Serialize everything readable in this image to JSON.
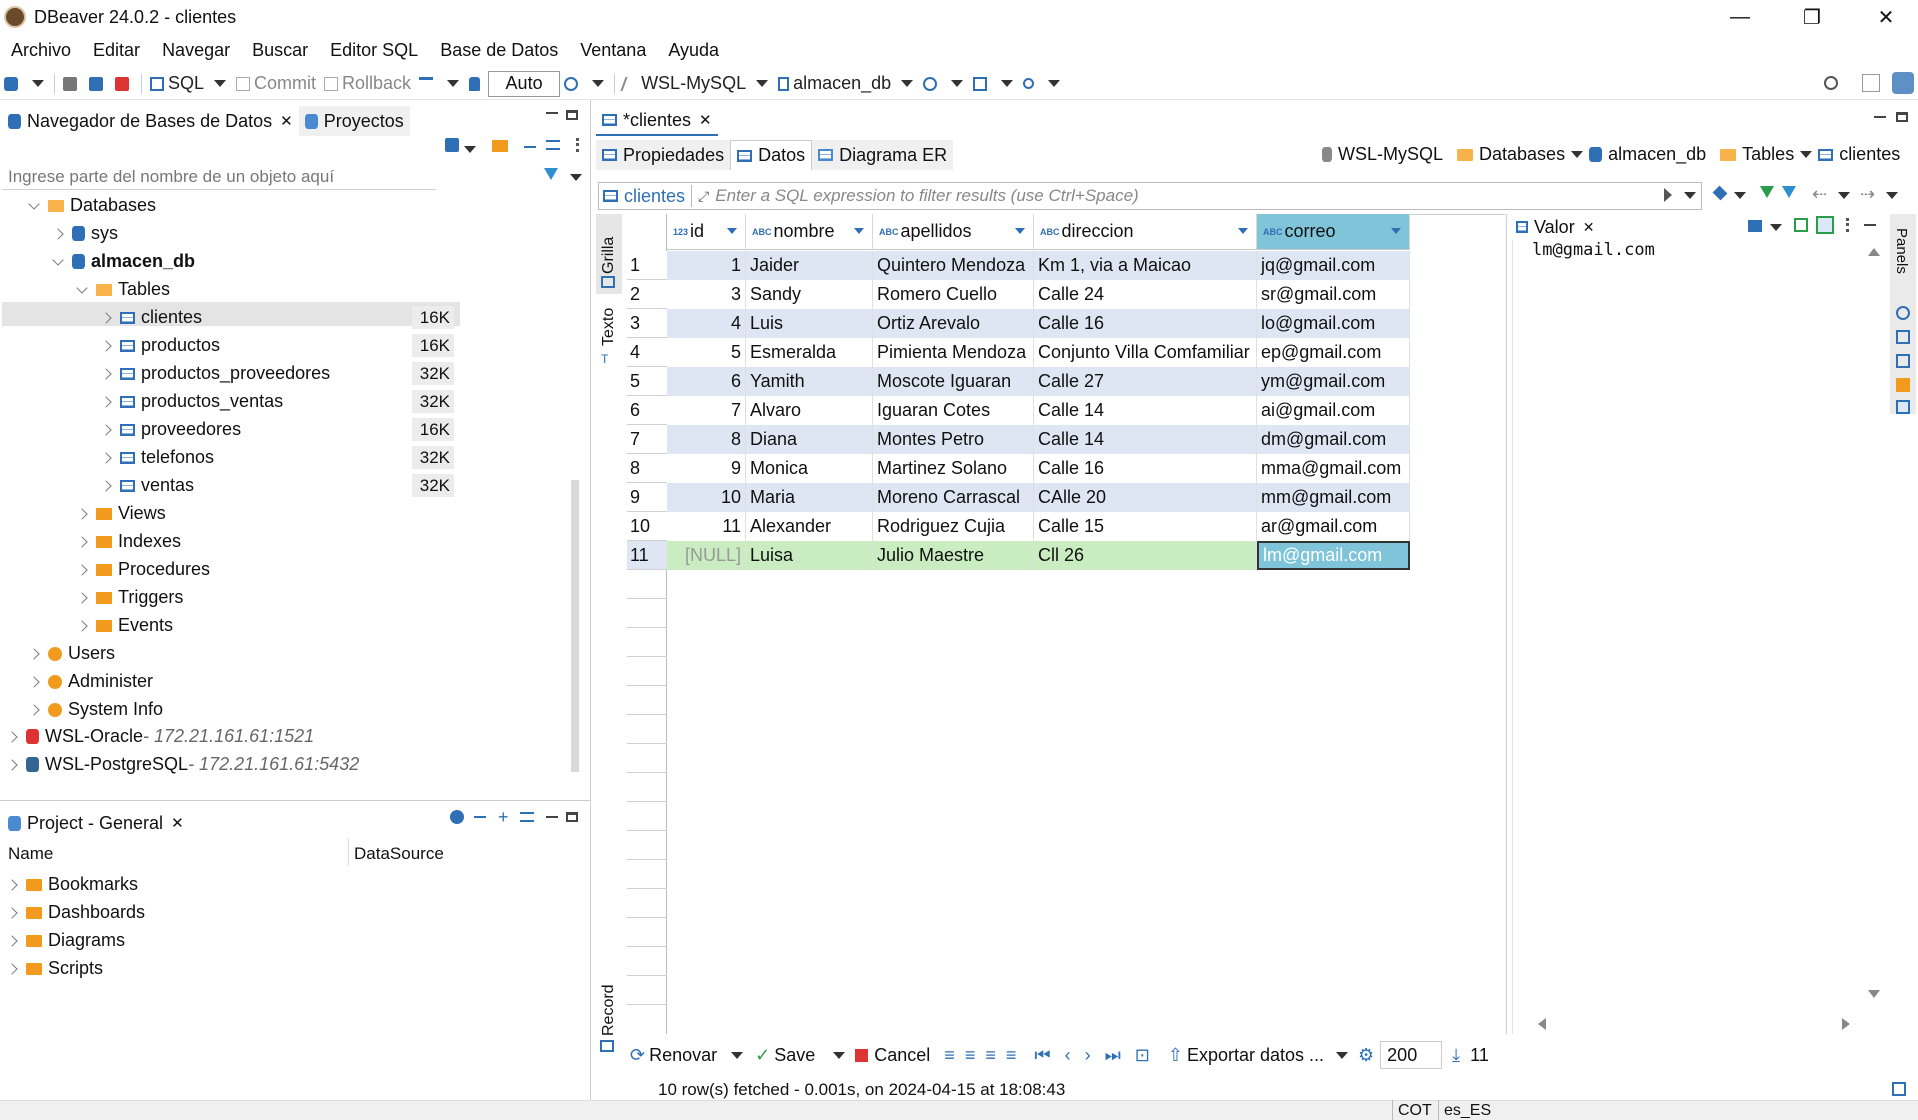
{
  "window": {
    "title": "DBeaver 24.0.2 - clientes",
    "minimize": "—",
    "maximize": "❐",
    "close": "✕"
  },
  "menu": [
    "Archivo",
    "Editar",
    "Navegar",
    "Buscar",
    "Editor SQL",
    "Base de Datos",
    "Ventana",
    "Ayuda"
  ],
  "toolbar": {
    "sql_label": "SQL",
    "commit_label": "Commit",
    "rollback_label": "Rollback",
    "auto_label": "Auto",
    "connection_label": "WSL-MySQL",
    "database_label": "almacen_db"
  },
  "navigator": {
    "tab_label": "Navegador de Bases de Datos",
    "projects_tab_label": "Proyectos",
    "filter_placeholder": "Ingrese parte del nombre de un objeto aquí",
    "databases_label": "Databases",
    "sys_label": "sys",
    "db_label": "almacen_db",
    "tables_label": "Tables",
    "tables": [
      {
        "name": "clientes",
        "size": "16K"
      },
      {
        "name": "productos",
        "size": "16K"
      },
      {
        "name": "productos_proveedores",
        "size": "32K"
      },
      {
        "name": "productos_ventas",
        "size": "32K"
      },
      {
        "name": "proveedores",
        "size": "16K"
      },
      {
        "name": "telefonos",
        "size": "32K"
      },
      {
        "name": "ventas",
        "size": "32K"
      }
    ],
    "folders": [
      "Views",
      "Indexes",
      "Procedures",
      "Triggers",
      "Events"
    ],
    "admin": [
      "Users",
      "Administer",
      "System Info"
    ],
    "connections": [
      {
        "name": "WSL-Oracle",
        "host": " - 172.21.161.61:1521"
      },
      {
        "name": "WSL-PostgreSQL",
        "host": " - 172.21.161.61:5432"
      }
    ]
  },
  "project": {
    "tab_label": "Project - General",
    "col_name": "Name",
    "col_datasource": "DataSource",
    "items": [
      "Bookmarks",
      "Dashboards",
      "Diagrams",
      "Scripts"
    ]
  },
  "editor": {
    "tab_label": "*clientes",
    "subtabs": [
      "Propiedades",
      "Datos",
      "Diagrama ER"
    ],
    "breadcrumb": [
      "WSL-MySQL",
      "Databases",
      "almacen_db",
      "Tables",
      "clientes"
    ],
    "filter_table": "clientes",
    "filter_placeholder": "Enter a SQL expression to filter results (use Ctrl+Space)",
    "side_grilla": "Grilla",
    "side_texto": "Texto",
    "side_record": "Record"
  },
  "grid": {
    "columns": [
      "id",
      "nombre",
      "apellidos",
      "direccion",
      "correo"
    ],
    "rows": [
      [
        "1",
        "Jaider",
        "Quintero Mendoza",
        "Km 1, via a Maicao",
        "jq@gmail.com"
      ],
      [
        "3",
        "Sandy",
        "Romero Cuello",
        "Calle 24",
        "sr@gmail.com"
      ],
      [
        "4",
        "Luis",
        "Ortiz Arevalo",
        "Calle 16",
        "lo@gmail.com"
      ],
      [
        "5",
        "Esmeralda",
        "Pimienta Mendoza",
        "Conjunto Villa Comfamiliar",
        "ep@gmail.com"
      ],
      [
        "6",
        "Yamith",
        "Moscote Iguaran",
        "Calle 27",
        "ym@gmail.com"
      ],
      [
        "7",
        "Alvaro",
        "Iguaran Cotes",
        "Calle 14",
        "ai@gmail.com"
      ],
      [
        "8",
        "Diana",
        "Montes Petro",
        "Calle 14",
        "dm@gmail.com"
      ],
      [
        "9",
        "Monica",
        "Martinez Solano",
        "Calle 16",
        "mma@gmail.com"
      ],
      [
        "10",
        "Maria",
        "Moreno Carrascal",
        "CAlle 20",
        "mm@gmail.com"
      ],
      [
        "11",
        "Alexander",
        "Rodriguez Cujia",
        "Calle 15",
        "ar@gmail.com"
      ],
      [
        "[NULL]",
        "Luisa",
        "Julio Maestre",
        "Cll 26",
        "lm@gmail.com"
      ]
    ],
    "row_numbers": [
      "1",
      "2",
      "3",
      "4",
      "5",
      "6",
      "7",
      "8",
      "9",
      "10",
      "11"
    ]
  },
  "value_panel": {
    "tab_label": "Valor",
    "value": "lm@gmail.com",
    "panels_label": "Panels"
  },
  "bottom": {
    "renovar": "Renovar",
    "save": "Save",
    "cancel": "Cancel",
    "export": "Exportar datos ...",
    "fetch_size": "200",
    "row_count": "11",
    "status": "10 row(s) fetched - 0.001s, on 2024-04-15 at 18:08:43",
    "tz": "COT",
    "locale": "es_ES"
  },
  "colors": {
    "stripe": "#dde6f2",
    "new_row": "#c9edc0",
    "selected_cell": "#7fc4d8",
    "accent": "#2f6fb5"
  }
}
